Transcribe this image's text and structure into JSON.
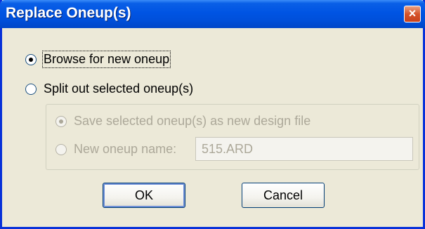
{
  "window": {
    "title": "Replace Oneup(s)",
    "close_label": "×"
  },
  "options": {
    "browse_label": "Browse for new oneup",
    "split_label": "Split out selected oneup(s)",
    "selected": "browse"
  },
  "split_group": {
    "save_as_design_label": "Save selected oneup(s) as new design file",
    "new_name_label": "New oneup name:",
    "new_name_value": "515.ARD",
    "enabled": false
  },
  "buttons": {
    "ok_label": "OK",
    "cancel_label": "Cancel"
  },
  "colors": {
    "titlebar": "#0054e3",
    "close_button": "#d5532a",
    "dialog_background": "#ece9d8",
    "disabled_text": "#aca899"
  }
}
